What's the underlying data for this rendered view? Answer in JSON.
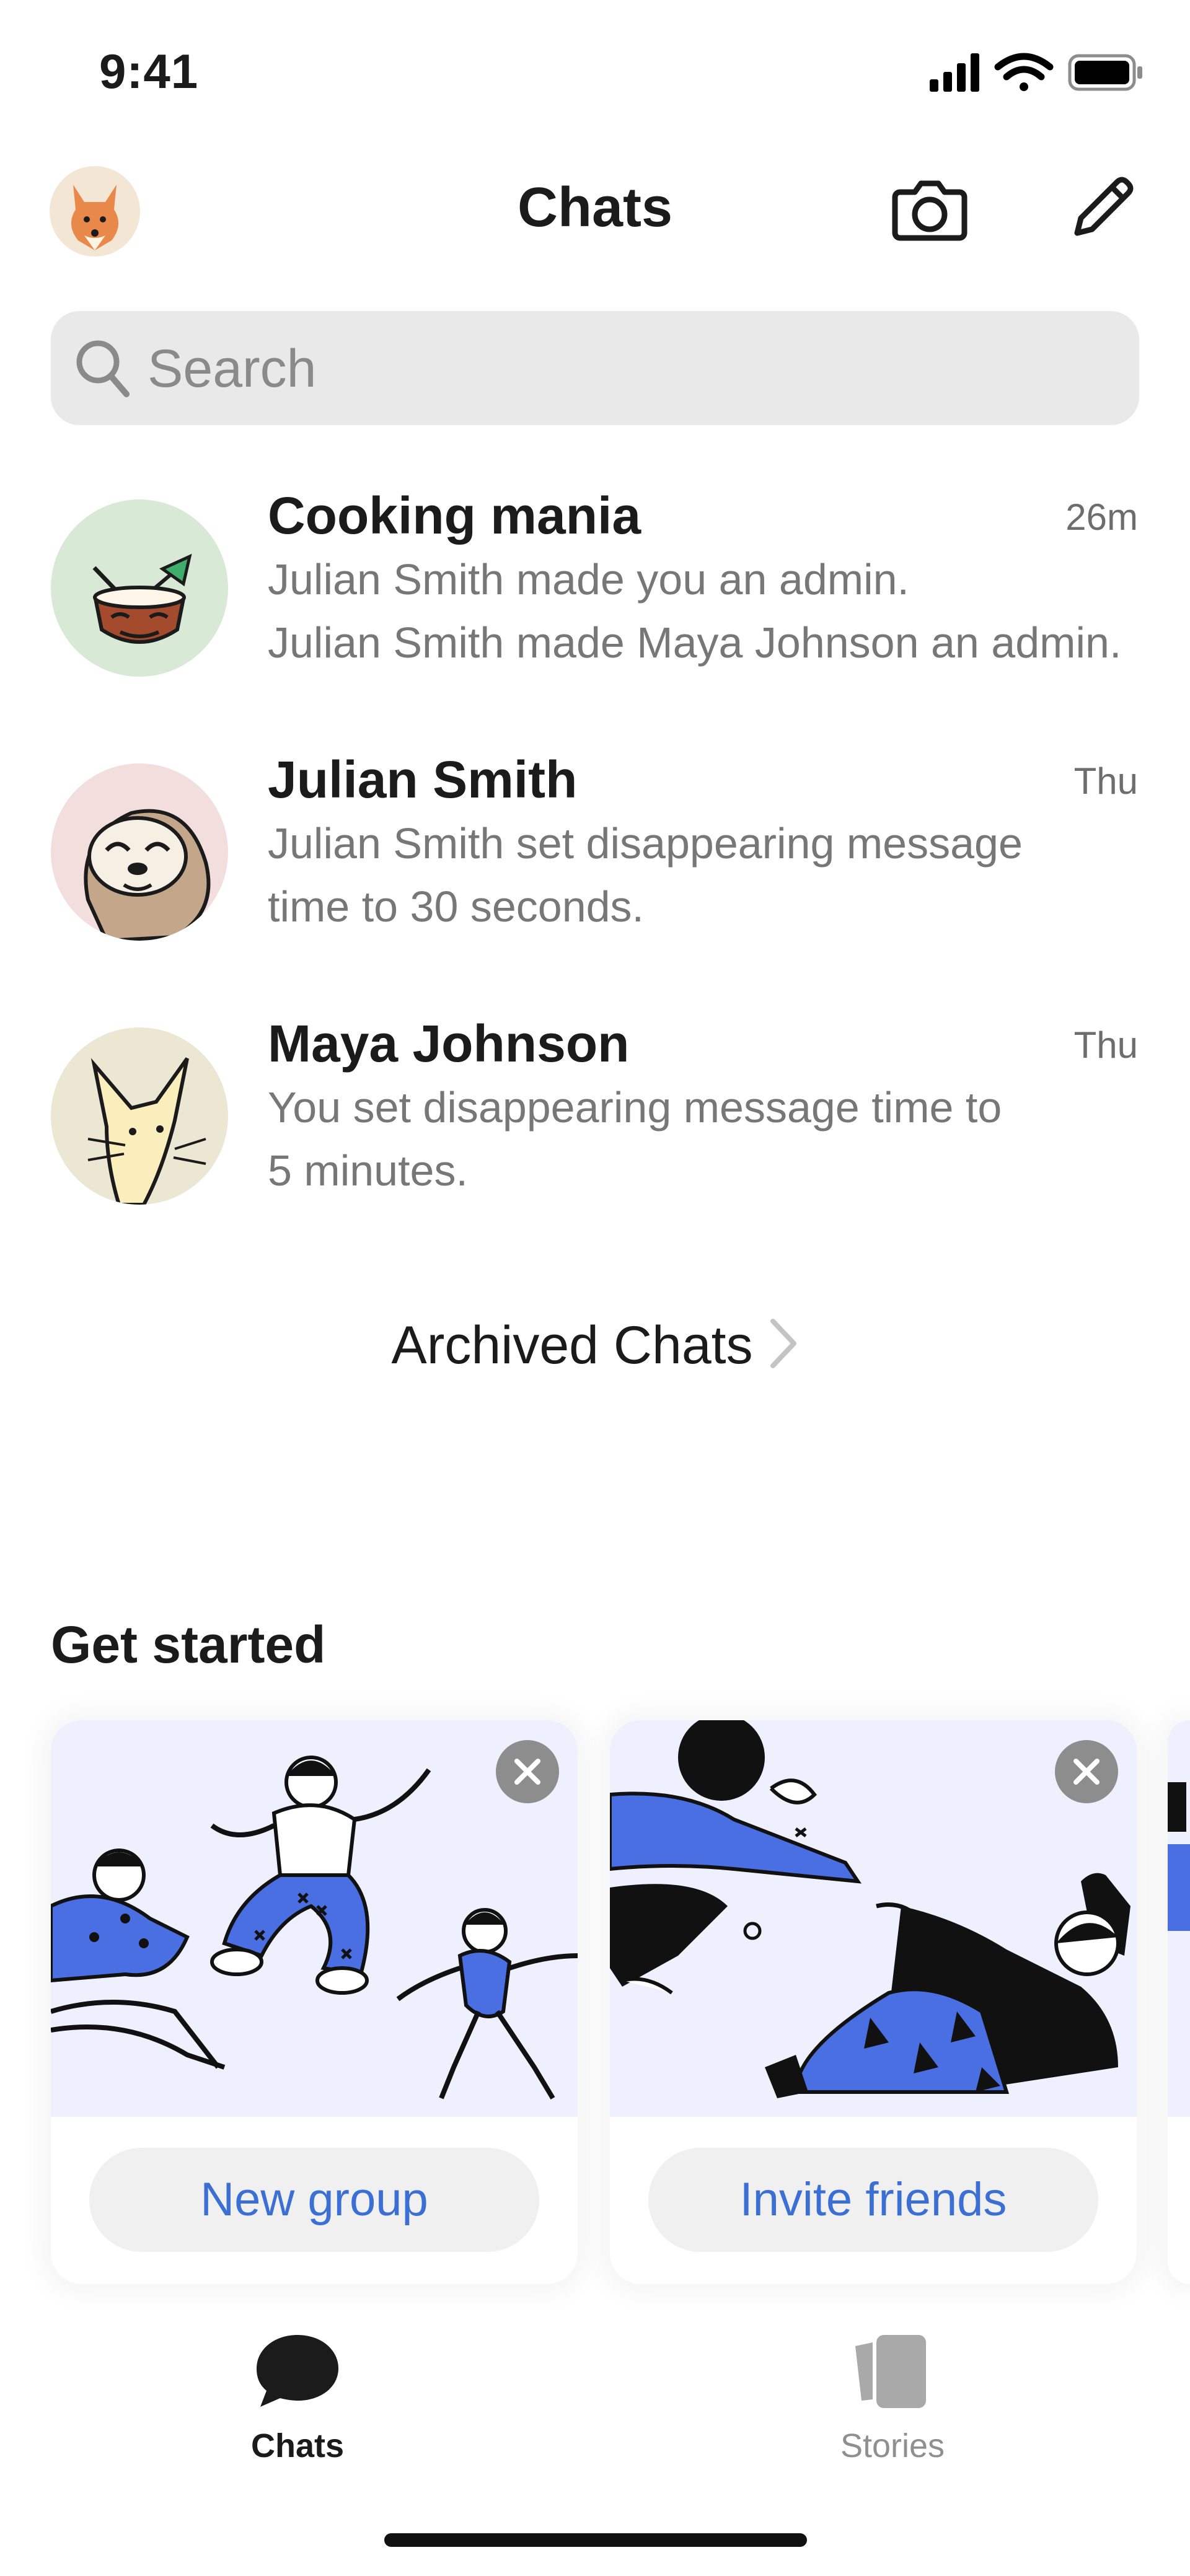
{
  "status_bar": {
    "time": "9:41"
  },
  "header": {
    "title": "Chats",
    "camera_icon": "camera-icon",
    "compose_icon": "compose-pencil-icon"
  },
  "search": {
    "placeholder": "Search",
    "value": ""
  },
  "chats": [
    {
      "name": "Cooking mania",
      "time": "26m",
      "preview_lines": [
        "Julian Smith made you an admin.",
        "Julian Smith made Maya Johnson an admin."
      ],
      "avatar": "coconut-drink-avatar",
      "avatar_bg": "#d8ead6"
    },
    {
      "name": "Julian Smith",
      "time": "Thu",
      "preview_lines": [
        "Julian  Smith set disappearing message",
        "time to 30 seconds."
      ],
      "avatar": "sloth-avatar",
      "avatar_bg": "#f3dede"
    },
    {
      "name": "Maya Johnson",
      "time": "Thu",
      "preview_lines": [
        "You set disappearing message time to",
        "5 minutes."
      ],
      "avatar": "fox-avatar",
      "avatar_bg": "#ece7d3"
    }
  ],
  "archived": {
    "label": "Archived Chats"
  },
  "get_started": {
    "title": "Get started",
    "cards": [
      {
        "button_label": "New group",
        "illustration": "people-jumping-illustration"
      },
      {
        "button_label": "Invite friends",
        "illustration": "people-reaching-illustration"
      }
    ]
  },
  "tabs": [
    {
      "label": "Chats",
      "icon": "chat-bubble-icon",
      "active": true
    },
    {
      "label": "Stories",
      "icon": "stories-icon",
      "active": false
    }
  ],
  "colors": {
    "accent": "#3b6fd4",
    "illustration_blue": "#4a6fe3",
    "muted_text": "#777777"
  }
}
